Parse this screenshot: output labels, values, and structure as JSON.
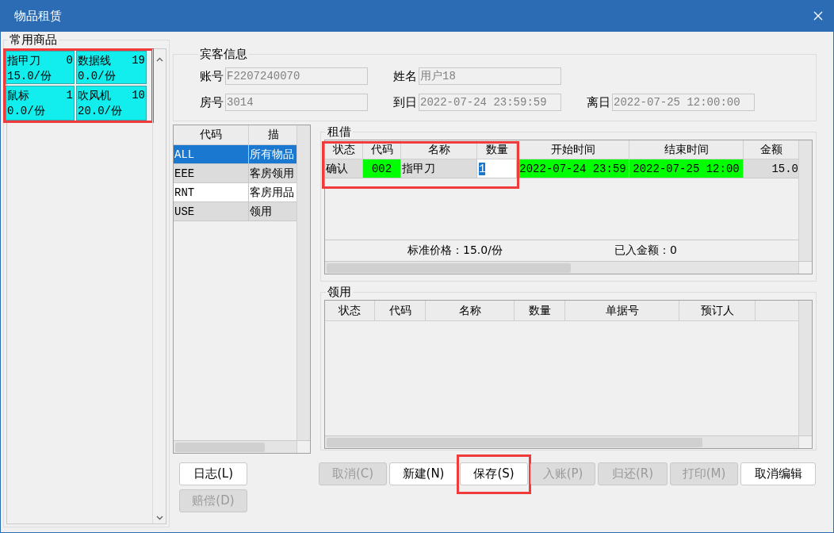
{
  "window": {
    "title": "物品租赁"
  },
  "favorites": {
    "title": "常用商品",
    "highlighted": true,
    "items": [
      {
        "name": "指甲刀",
        "count": "0",
        "price": "15.0/份"
      },
      {
        "name": "数据线",
        "count": "19",
        "price": "0.0/份"
      },
      {
        "name": "鼠标",
        "count": "1",
        "price": "0.0/份"
      },
      {
        "name": "吹风机",
        "count": "10",
        "price": "20.0/份"
      }
    ]
  },
  "guest": {
    "title": "宾客信息",
    "rows": [
      [
        {
          "label": "账号",
          "value": "F2207240070"
        },
        {
          "label": "姓名",
          "value": "用户18"
        }
      ],
      [
        {
          "label": "房号",
          "value": "3014"
        },
        {
          "label": "到日",
          "value": "2022-07-24 23:59:59"
        },
        {
          "label": "离日",
          "value": "2022-07-25 12:00:00"
        }
      ]
    ]
  },
  "categories": {
    "columns": [
      "代码",
      "描"
    ],
    "rows": [
      {
        "code": "ALL",
        "description": "所有物品",
        "selected": true
      },
      {
        "code": "EEE",
        "description": "客房领用",
        "selected": false
      },
      {
        "code": "RNT",
        "description": "客房用品",
        "selected": false
      },
      {
        "code": "USE",
        "description": "领用",
        "selected": false
      }
    ]
  },
  "rental": {
    "title": "租借",
    "highlighted": true,
    "columns": [
      "状态",
      "代码",
      "名称",
      "数量",
      "开始时间",
      "结束时间",
      "金额"
    ],
    "rows": [
      {
        "cells": [
          {
            "kind": "text",
            "text": "确认"
          },
          {
            "kind": "text",
            "text": "002",
            "color": "#00ff00"
          },
          {
            "kind": "text",
            "text": "指甲刀"
          },
          {
            "kind": "input",
            "text": "1"
          },
          {
            "kind": "text",
            "text": "2022-07-24 23:59",
            "color": "#00ff00"
          },
          {
            "kind": "text",
            "text": "2022-07-25 12:00",
            "color": "#00ff00"
          },
          {
            "kind": "text",
            "text": "15.0"
          }
        ]
      }
    ],
    "standard_price": "标准价格：15.0/份",
    "paid_amount": "已入金额：0"
  },
  "usage": {
    "title": "领用",
    "columns": [
      "状态",
      "代码",
      "名称",
      "数量",
      "单据号",
      "预订人"
    ]
  },
  "side_buttons": [
    {
      "label": "日志(L)",
      "disabled": false
    },
    {
      "label": "赔偿(D)",
      "disabled": true
    }
  ],
  "buttons": [
    {
      "label": "取消(C)",
      "disabled": true,
      "highlighted": false
    },
    {
      "label": "新建(N)",
      "disabled": false,
      "highlighted": false
    },
    {
      "label": "保存(S)",
      "disabled": false,
      "highlighted": true
    },
    {
      "label": "入账(P)",
      "disabled": true,
      "highlighted": false
    },
    {
      "label": "归还(R)",
      "disabled": true,
      "highlighted": false
    },
    {
      "label": "打印(M)",
      "disabled": true,
      "highlighted": false
    },
    {
      "label": "取消编辑",
      "disabled": false,
      "highlighted": false
    }
  ]
}
